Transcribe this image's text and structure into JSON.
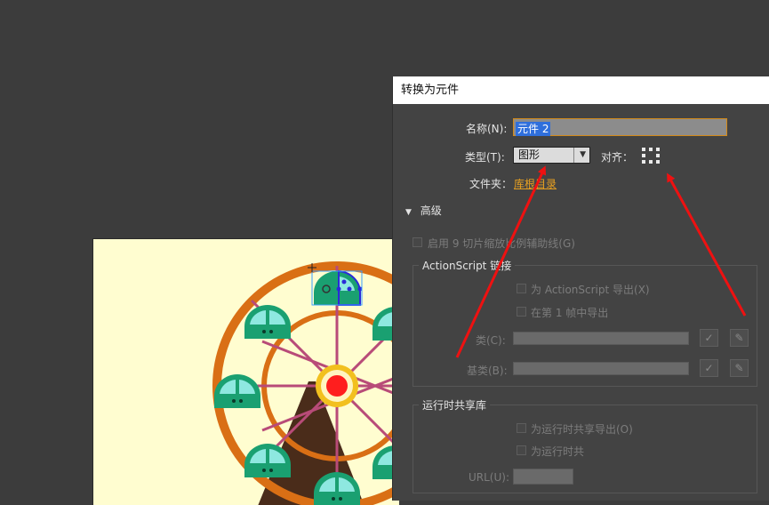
{
  "dialog": {
    "title": "转换为元件",
    "name_label": "名称(N):",
    "name_value": "元件 2",
    "type_label": "类型(T):",
    "type_value": "图形",
    "align_label": "对齐：",
    "folder_label": "文件夹：",
    "folder_value": "库根目录",
    "advanced_label": "高级",
    "enable_9slice": "启用 9 切片缩放比例辅助线(G)",
    "actionscript": {
      "group_title": "ActionScript 链接",
      "export_for_as": "为 ActionScript 导出(X)",
      "export_frame": "在第  1  帧中导出",
      "class_label": "类(C):",
      "base_class_label": "基类(B):"
    },
    "runtime_sharing": {
      "group_title": "运行时共享库",
      "export_for_runtime": "为运行时共享导出(O)",
      "import_for_runtime": "为运行时共",
      "url_label": "URL(U):"
    }
  },
  "colors": {
    "canvas_bg": "#3c3c3c",
    "stage_bg": "#fffdd0",
    "wheel_rim": "#d96f15",
    "spoke": "#b84b78",
    "hub": "#ff1e1e",
    "hub_ring": "#f2c01e",
    "cabin": "#1aa071",
    "annotation_arrow": "#ee1111"
  }
}
